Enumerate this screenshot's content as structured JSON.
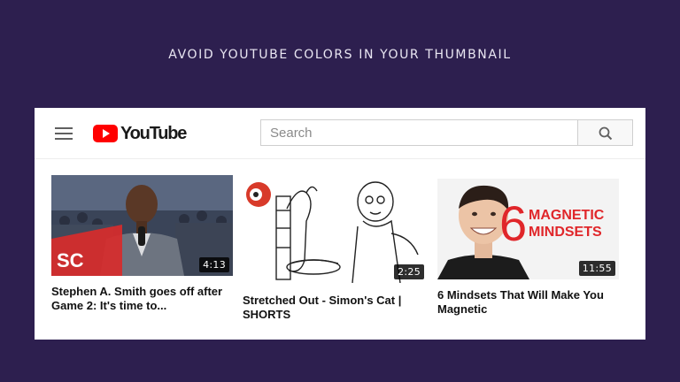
{
  "slide": {
    "title": "AVOID YOUTUBE COLORS IN YOUR THUMBNAIL"
  },
  "colors": {
    "background": "#2d1f4f",
    "youtube_red": "#ff0000",
    "panel": "#ffffff"
  },
  "header": {
    "menu_icon": "hamburger-menu-icon",
    "logo_text": "YouTube",
    "search": {
      "placeholder": "Search",
      "value": ""
    },
    "search_icon": "search-icon"
  },
  "videos": [
    {
      "title": "Stephen A. Smith goes off after Game 2: It's time to...",
      "duration": "4:13",
      "badge": "SC"
    },
    {
      "title": "Stretched Out - Simon's Cat | SHORTS",
      "duration": "2:25"
    },
    {
      "title": "6 Mindsets That Will Make You Magnetic",
      "duration": "11:55",
      "thumb_text_number": "6",
      "thumb_text_line1": "MAGNETIC",
      "thumb_text_line2": "MINDSETS"
    }
  ]
}
